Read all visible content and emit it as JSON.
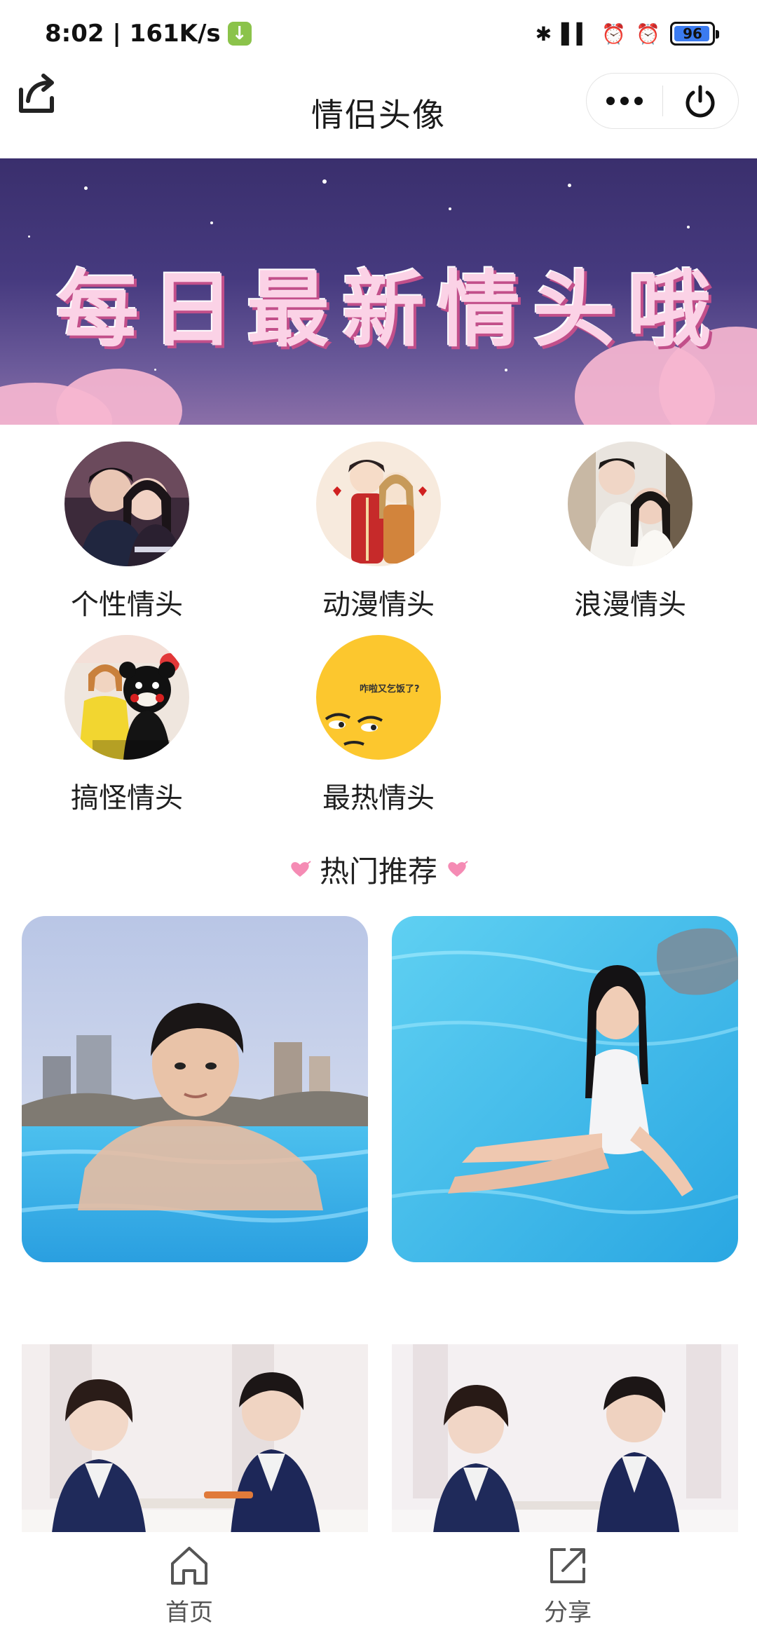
{
  "status_bar": {
    "time_speed": "8:02 | 161K/s",
    "battery": "96",
    "battery_level": 0.96
  },
  "nav": {
    "title": "情侣头像"
  },
  "banner": {
    "text": "每日最新情头哦"
  },
  "categories": [
    {
      "label": "个性情头",
      "icon": "couple-photo"
    },
    {
      "label": "动漫情头",
      "icon": "anime-couple"
    },
    {
      "label": "浪漫情头",
      "icon": "romantic-couple"
    },
    {
      "label": "搞怪情头",
      "icon": "funny-bear"
    },
    {
      "label": "最热情头",
      "icon": "emoji-face",
      "avatar_text": "咋啦又乞饭了?"
    }
  ],
  "section": {
    "title": "热门推荐"
  },
  "tabs": [
    {
      "label": "首页",
      "icon": "home-icon"
    },
    {
      "label": "分享",
      "icon": "share-icon"
    }
  ],
  "colors": {
    "banner_top": "#3a2f6d",
    "banner_text": "#fbd2e6",
    "pool_blue": "#46c6ea",
    "heart_pink": "#f58bb4"
  }
}
